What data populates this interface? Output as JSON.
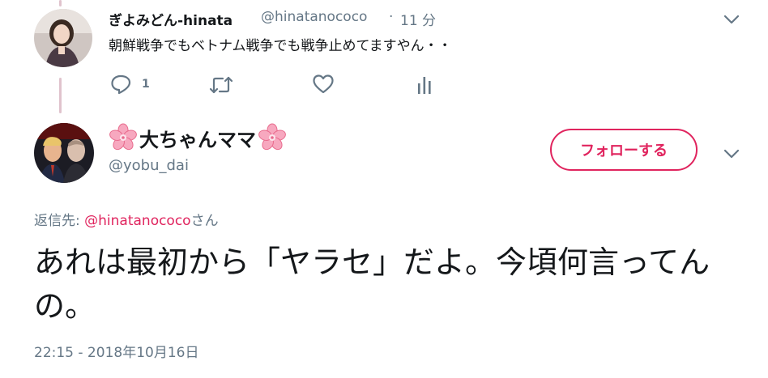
{
  "reply": {
    "display_name": "ぎよみどん-hinata",
    "handle": "@hinatanococo",
    "separator": "·",
    "time_ago": "11 分",
    "text": "朝鮮戦争でもベトナム戦争でも戦争止めてますやん・・",
    "reply_count": "1"
  },
  "main": {
    "display_name": "大ちゃんママ",
    "handle": "@yobu_dai",
    "follow_label": "フォローする",
    "replying_prefix": "返信先: ",
    "replying_mention": "@hinatanococo",
    "replying_suffix": "さん",
    "text": "あれは最初から「ヤラセ」だよ。今頃何言ってんの。",
    "timestamp": "22:15 - 2018年10月16日"
  },
  "colors": {
    "accent": "#e0245e",
    "secondary_text": "#657786",
    "thread_line": "#e0c3cd"
  },
  "icons": [
    "reply-icon",
    "retweet-icon",
    "like-icon",
    "analytics-icon",
    "chevron-down-icon",
    "cherry-blossom-icon"
  ]
}
